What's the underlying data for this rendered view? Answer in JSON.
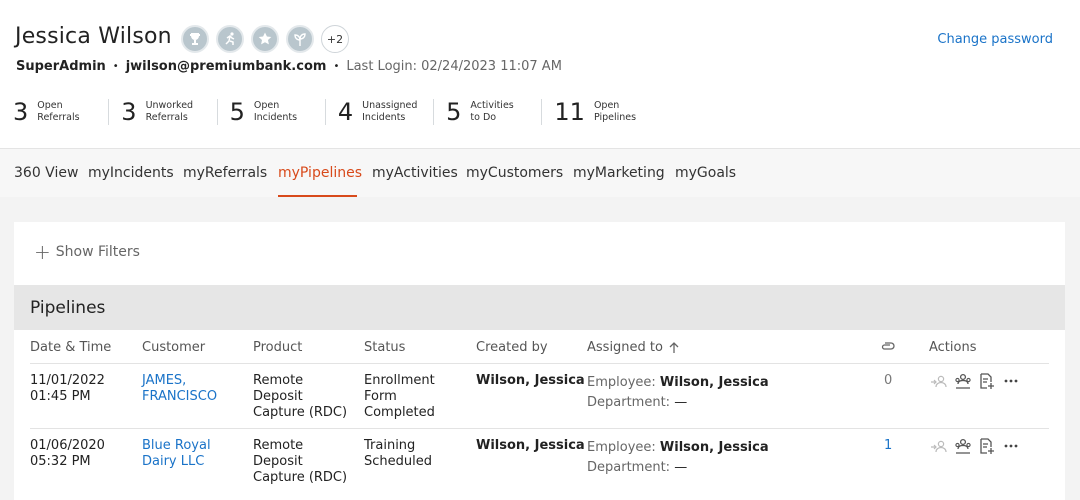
{
  "profile": {
    "name": "Jessica Wilson",
    "role": "SuperAdmin",
    "email": "jwilson@premiumbank.com",
    "last_login": "Last Login: 02/24/2023 11:07 AM",
    "change_password": "Change password",
    "badges": [
      "trophy-badge-icon",
      "runner-badge-icon",
      "star-badge-icon",
      "plant-badge-icon"
    ],
    "badges_more": "+2"
  },
  "stats": [
    {
      "value": "3",
      "label": "Open\nReferrals"
    },
    {
      "value": "3",
      "label": "Unworked\nReferrals"
    },
    {
      "value": "5",
      "label": "Open\nIncidents"
    },
    {
      "value": "4",
      "label": "Unassigned\nIncidents"
    },
    {
      "value": "5",
      "label": "Activities\nto Do"
    },
    {
      "value": "11",
      "label": "Open\nPipelines"
    }
  ],
  "tabs": [
    "360 View",
    "myIncidents",
    "myReferrals",
    "myPipelines",
    "myActivities",
    "myCustomers",
    "myMarketing",
    "myGoals"
  ],
  "active_tab": "myPipelines",
  "filters": {
    "label": "Show Filters"
  },
  "pipelines": {
    "title": "Pipelines",
    "columns": [
      "Date & Time",
      "Customer",
      "Product",
      "Status",
      "Created by",
      "Assigned to",
      "Actions"
    ],
    "rows": [
      {
        "date": "11/01/2022",
        "time": "01:45 PM",
        "customer_line1": "JAMES,",
        "customer_line2": "FRANCISCO",
        "product_line1": "Remote",
        "product_line2": "Deposit",
        "product_line3": "Capture (RDC)",
        "status_line1": "Enrollment",
        "status_line2": "Form",
        "status_line3": "Completed",
        "created_by": "Wilson, Jessica",
        "employee_label": "Employee:",
        "employee": "Wilson, Jessica",
        "department_label": "Department:",
        "department": "—",
        "attachments": "0"
      },
      {
        "date": "01/06/2020",
        "time": "05:32 PM",
        "customer_line1": "Blue Royal",
        "customer_line2": "Dairy LLC",
        "product_line1": "Remote",
        "product_line2": "Deposit",
        "product_line3": "Capture (RDC)",
        "status_line1": "Training",
        "status_line2": "Scheduled",
        "status_line3": "",
        "created_by": "Wilson, Jessica",
        "employee_label": "Employee:",
        "employee": "Wilson, Jessica",
        "department_label": "Department:",
        "department": "—",
        "attachments": "1"
      }
    ]
  },
  "colors": {
    "accent": "#d84a1b",
    "link": "#1a73c8",
    "header_gray": "#e6e6e6"
  }
}
